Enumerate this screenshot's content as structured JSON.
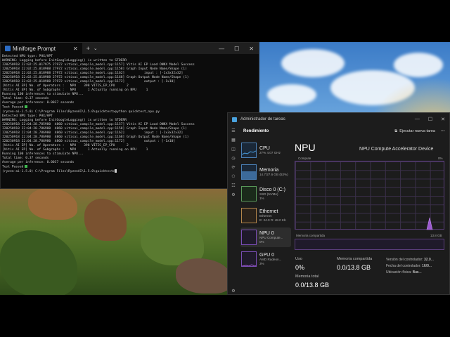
{
  "terminal": {
    "tab_title": "Miniforge Prompt",
    "new_tab": "+",
    "dropdown": "⌄",
    "lines": [
      "Detected NPU type: PHX/HPT",
      "WARNING: Logging before InitGoogleLogging() is written to STDERR",
      "I20250918 22:02:25.017975 27972 vitisai_compile_model.cpp:1157] Vitis AI EP Load ONNX Model Success",
      "I20250918 22:02:25.018988 27972 vitisai_compile_model.cpp:1158] Graph Input Node Name/Shape (1)",
      "I20250918 22:02:25.018988 27972 vitisai_compile_model.cpp:1162]          input : [-1x3x32x32]",
      "I20250918 22:02:25.018988 27972 vitisai_compile_model.cpp:1168] Graph Output Node Name/Shape (1)",
      "I20250918 22:02:25.018988 27972 vitisai_compile_model.cpp:1172]          output : [-1x10]",
      "[Vitis AI EP] No. of Operators :   NPU    398 VITIS_EP_CPU      2",
      "[Vitis AI EP] No. of Subgraphs :   NPU      1 Actually running on NPU     1",
      "Running 100 inferences to stimulate NPU...",
      "Total time: 0.37 seconds",
      "Average per inference: 0.0037 seconds",
      "Test Passed",
      "",
      "(ryzen-ai-1.5.0) C:\\Program Files\\RyzenAI\\1.5.0\\quicktest>python quicktest_npu.py",
      "Detected NPU type: PHX/HPT",
      "WARNING: Logging before InitGoogleLogging() is written to STDERR",
      "I20250918 22:04:28.785980  4860 vitisai_compile_model.cpp:1157] Vitis AI EP Load ONNX Model Success",
      "I20250918 22:04:28.786980  4860 vitisai_compile_model.cpp:1158] Graph Input Node Name/Shape (1)",
      "I20250918 22:04:28.786980  4860 vitisai_compile_model.cpp:1162]          input : [-1x3x32x32]",
      "I20250918 22:04:28.786980  4860 vitisai_compile_model.cpp:1168] Graph Output Node Name/Shape (1)",
      "I20250918 22:04:28.786980  4860 vitisai_compile_model.cpp:1172]          output : [-1x10]",
      "[Vitis AI EP] No. of Operators :   NPU    398 VITIS_EP_CPU      2",
      "[Vitis AI EP] No. of Subgraphs :   NPU      1 Actually running on NPU     1",
      "Running 100 inferences to stimulate NPU...",
      "Total time: 0.37 seconds",
      "Average per inference: 0.0037 seconds",
      "Test Passed",
      "",
      "(ryzen-ai-1.5.0) C:\\Program Files\\RyzenAI\\1.5.0\\quicktest>"
    ]
  },
  "taskmanager": {
    "title": "Administrador de tareas",
    "section": "Rendimiento",
    "run_task": "Ejecutar nueva tarea",
    "more": "···",
    "devices": [
      {
        "name": "CPU",
        "sub": "27% 4.07 GHz"
      },
      {
        "name": "Memoria",
        "sub": "14.7/27.6 GB (53%)"
      },
      {
        "name": "Disco 0 (C:)",
        "sub": "SSD (NVMe)",
        "sub2": "1%"
      },
      {
        "name": "Ethernet",
        "sub": "Ethernet",
        "sub2": "E: 24.0 R: 48.0 Kb"
      },
      {
        "name": "NPU 0",
        "sub": "NPU Compute...",
        "sub2": "0%"
      },
      {
        "name": "GPU 0",
        "sub": "AMD Radeon...",
        "sub2": "3%"
      }
    ],
    "detail": {
      "title": "NPU",
      "model": "NPU Compute Accelerator Device",
      "graph_label": "Compute",
      "graph_max": "0%",
      "mem_label": "Memoria compartida",
      "mem_max": "13.8 GB",
      "uso_label": "Uso",
      "uso_value": "0%",
      "memshared_label": "Memoria compartida",
      "memshared_value": "0.0/13.8 GB",
      "memtotal_label": "Memoria total",
      "memtotal_value": "0.0/13.8 GB",
      "driver_version_label": "Versión del controlador:",
      "driver_version_value": "32.0...",
      "driver_date_label": "Fecha del controlador:",
      "driver_date_value": "16/0...",
      "location_label": "Ubicación física:",
      "location_value": "Bus..."
    },
    "accent": "#9b59d0"
  }
}
